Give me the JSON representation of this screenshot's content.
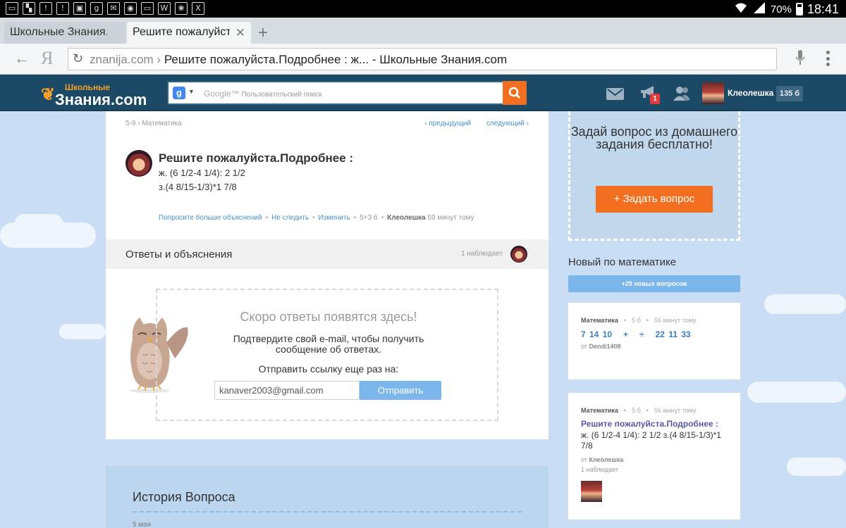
{
  "status_bar": {
    "battery": "70%",
    "time": "18:41"
  },
  "browser": {
    "tabs": [
      {
        "title": "Школьные Знания.с",
        "active": false
      },
      {
        "title": "Решите пожалуйста",
        "active": true
      }
    ],
    "new_tab_glyph": "+",
    "url_domain": "znanija.com",
    "url_sep": " › ",
    "url_title": "Решите пожалуйста.Подробнее : ж... - Школьные Знания.com",
    "ya_logo": "Я"
  },
  "site_header": {
    "logo_small": "Школьные",
    "logo_big": "Знания.com",
    "search_google": "Google™",
    "search_placeholder": "Пользовательский поиск",
    "notification_count": "1",
    "username": "Клеолешка",
    "points": "135 б"
  },
  "question": {
    "breadcrumb": "5-9 › Математика",
    "prev": "‹  предыдущий",
    "next": "следующий  ›",
    "title": "Решите пожалуйста.Подробнее :",
    "line1": "ж. (6 1/2-4 1/4): 2 1/2",
    "line2": "з.(4 8/15-1/3)*1 7/8",
    "actions": {
      "ask_more": "Попросите больше объяснений",
      "unfollow": "Не следить",
      "edit": "Изменить",
      "points": "5+3 б",
      "author": "Клеолешка",
      "time": "59 минут тому"
    }
  },
  "answers": {
    "title": "Ответы и объяснения",
    "watchers": "1 наблюдает",
    "soon": "Скоро ответы появятся здесь!",
    "confirm": "Подтвердите свой e-mail, чтобы получить сообщение об ответах.",
    "resend": "Отправить ссылку еще раз на:",
    "email": "kanaver2003@gmail.com",
    "send_button": "Отправить"
  },
  "history": {
    "title": "История Вопроса",
    "date": "5 мая"
  },
  "sidebar": {
    "ask_text": "Задай вопрос из домашнего задания бесплатно!",
    "ask_button": "+  Задать вопрос",
    "new_title": "Новый по математике",
    "new_button": "+20 новых вопросов",
    "cards": [
      {
        "subject": "Математика",
        "points": "5 б",
        "time": "56 минут тому",
        "text": "7 14 10   +   ÷   22 11 33",
        "from_label": "от",
        "author": "Dendi1408"
      },
      {
        "subject": "Математика",
        "points": "5 б",
        "time": "56 минут тому",
        "title": "Решите пожалуйста.Подробнее :",
        "text": "ж. (6 1/2-4 1/4): 2 1/2 з.(4 8/15-1/3)*1 7/8",
        "from_label": "от",
        "author": "Клеолешка",
        "watchers": "1 наблюдает"
      }
    ]
  },
  "colors": {
    "header_bg": "#1c4966",
    "accent_orange": "#f26f21",
    "link_blue": "#4a90c8",
    "button_blue": "#7ab6ec",
    "page_bg": "#c9def4"
  }
}
